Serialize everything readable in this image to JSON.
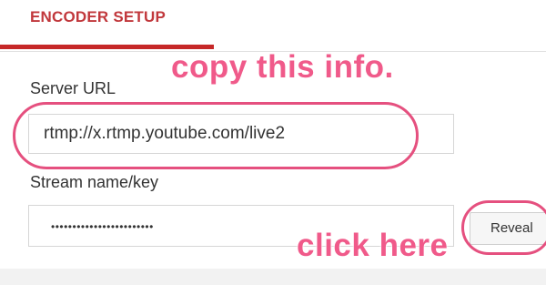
{
  "header": {
    "title": "ENCODER SETUP"
  },
  "fields": {
    "server_url": {
      "label": "Server URL",
      "value": "rtmp://x.rtmp.youtube.com/live2"
    },
    "stream_key": {
      "label": "Stream name/key",
      "value": "••••••••••••••••••••••••"
    },
    "reveal_label": "Reveal"
  },
  "annotations": {
    "copy": "copy this info.",
    "click": "click here"
  },
  "colors": {
    "accent": "#c62828",
    "annotation": "#f05a8a"
  }
}
